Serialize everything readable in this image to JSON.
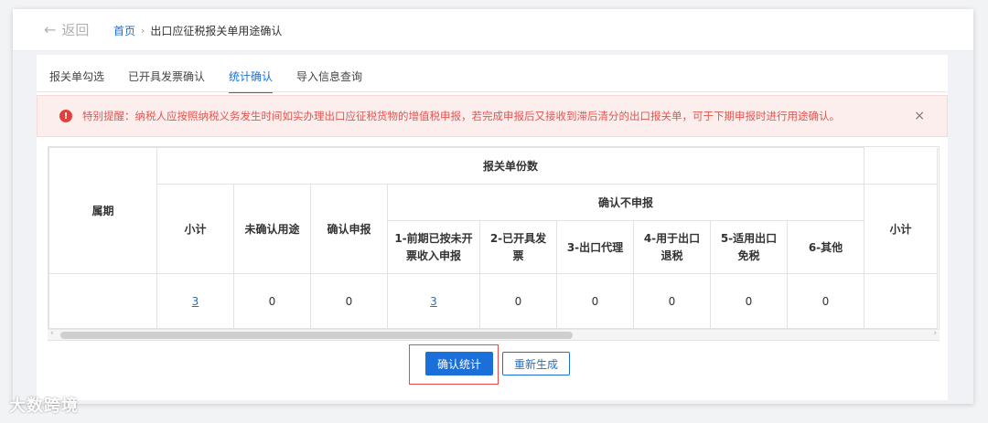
{
  "header": {
    "back_label": "返回",
    "back_arrow": "←",
    "breadcrumb_home": "首页",
    "breadcrumb_sep": "›",
    "breadcrumb_current": "出口应征税报关单用途确认"
  },
  "tabs": [
    {
      "label": "报关单勾选"
    },
    {
      "label": "已开具发票确认"
    },
    {
      "label": "统计确认"
    },
    {
      "label": "导入信息查询"
    }
  ],
  "active_tab": 2,
  "alert": {
    "icon": "!",
    "text": "特别提醒：纳税人应按照纳税义务发生时间如实办理出口应征税货物的增值税申报，若完成申报后又接收到滞后清分的出口报关单，可于下期申报时进行用途确认。",
    "close": "×"
  },
  "table": {
    "period_header": "属期",
    "group_header": "报关单份数",
    "subgroup_header": "确认不申报",
    "subtotal_header": "小计",
    "unconfirmed_header": "未确认用途",
    "confirm_declare_header": "确认申报",
    "cols": [
      "1-前期已按未开票收入申报",
      "2-已开具发票",
      "3-出口代理",
      "4-用于出口退税",
      "5-适用出口免税",
      "6-其他"
    ],
    "right_subtotal_header": "小计",
    "row": {
      "period": "",
      "subtotal": "3",
      "unconfirmed": "0",
      "confirm_declare": "0",
      "c1": "3",
      "c2": "0",
      "c3": "0",
      "c4": "0",
      "c5": "0",
      "c6": "0"
    }
  },
  "scroll": {
    "left": "‹",
    "right": "›"
  },
  "buttons": {
    "confirm_stats": "确认统计",
    "regenerate": "重新生成"
  },
  "watermark": "大数跨境",
  "colors": {
    "primary": "#1b6fd8",
    "alert_bg": "#fdeeee",
    "alert_text": "#e2554e",
    "highlight": "#e34b4b"
  }
}
